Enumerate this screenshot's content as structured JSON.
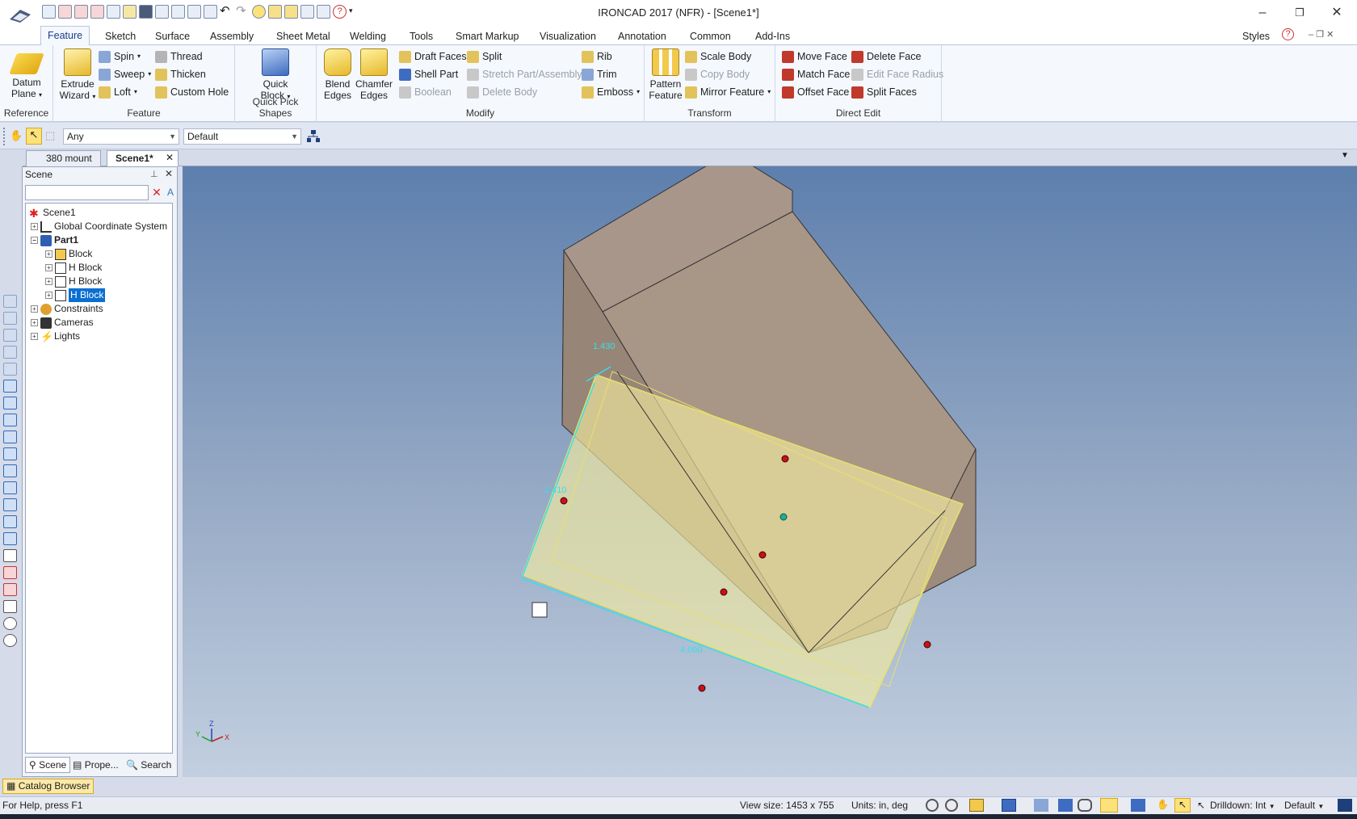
{
  "window": {
    "title": "IRONCAD 2017 (NFR) - [Scene1*]",
    "minimize": "–",
    "restore": "❐",
    "close": "✕"
  },
  "tabs": [
    "Feature",
    "Sketch",
    "Surface",
    "Assembly",
    "Sheet Metal",
    "Welding",
    "Tools",
    "Smart Markup",
    "Visualization",
    "Annotation",
    "Common",
    "Add-Ins"
  ],
  "tabs_right": {
    "styles": "Styles",
    "help": "?"
  },
  "ribbon": {
    "reference": {
      "label": "Reference",
      "datum_plane": "Datum Plane"
    },
    "feature": {
      "label": "Feature",
      "extrude_wizard": "Extrude Wizard",
      "spin": "Spin",
      "sweep": "Sweep",
      "loft": "Loft",
      "thread": "Thread",
      "thicken": "Thicken",
      "custom_hole": "Custom Hole"
    },
    "quick_pick": {
      "label": "Quick Pick Shapes",
      "quick_block": "Quick Block"
    },
    "modify": {
      "label": "Modify",
      "blend_edges": "Blend Edges",
      "chamfer_edges": "Chamfer Edges",
      "draft_faces": "Draft Faces",
      "shell_part": "Shell Part",
      "boolean": "Boolean",
      "split": "Split",
      "stretch": "Stretch Part/Assembly",
      "delete_body": "Delete Body",
      "rib": "Rib",
      "trim": "Trim",
      "emboss": "Emboss"
    },
    "transform": {
      "label": "Transform",
      "pattern_feature": "Pattern Feature",
      "scale_body": "Scale Body",
      "copy_body": "Copy Body",
      "mirror_feature": "Mirror Feature"
    },
    "direct_edit": {
      "label": "Direct Edit",
      "move_face": "Move Face",
      "match_face": "Match Face",
      "offset_face": "Offset Face",
      "delete_face": "Delete Face",
      "edit_face_radius": "Edit Face Radius",
      "split_faces": "Split Faces"
    }
  },
  "selection_bar": {
    "filter": "Any",
    "style": "Default"
  },
  "doc_tabs": [
    "380 mount",
    "Scene1*"
  ],
  "scene_panel": {
    "title": "Scene",
    "tree": [
      {
        "label": "Scene1",
        "level": 0,
        "expander": ""
      },
      {
        "label": "Global Coordinate System",
        "level": 1,
        "expander": "+"
      },
      {
        "label": "Part1",
        "level": 1,
        "expander": "−",
        "bold": true
      },
      {
        "label": "Block",
        "level": 2,
        "expander": "+"
      },
      {
        "label": "H Block",
        "level": 2,
        "expander": "+"
      },
      {
        "label": "H Block",
        "level": 2,
        "expander": "+"
      },
      {
        "label": "H Block",
        "level": 2,
        "expander": "+",
        "selected": true
      },
      {
        "label": "Constraints",
        "level": 1,
        "expander": "+"
      },
      {
        "label": "Cameras",
        "level": 1,
        "expander": "+"
      },
      {
        "label": "Lights",
        "level": 1,
        "expander": "+"
      }
    ],
    "bottom_tabs": [
      "Scene",
      "Prope...",
      "Search"
    ]
  },
  "viewport": {
    "dimensions": [
      "1.430",
      "2.410",
      "4.090"
    ],
    "triad": {
      "x": "X",
      "y": "Y",
      "z": "Z"
    }
  },
  "catalog_browser": "Catalog Browser",
  "status": {
    "help": "For Help, press F1",
    "view_size": "View size: 1453 x 755",
    "units": "Units: in, deg",
    "drilldown": "Drilldown: Int",
    "default": "Default"
  },
  "colors": {
    "accent": "#1a3e8c",
    "selection": "#0a6fd1",
    "body": "#a89687",
    "hblock": "#f2eba0"
  }
}
